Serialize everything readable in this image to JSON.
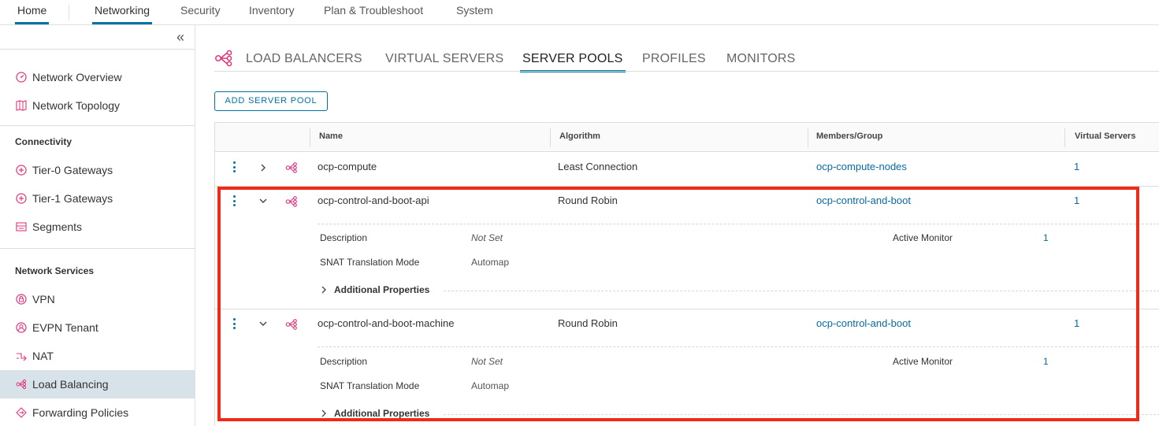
{
  "topnav": {
    "items": [
      {
        "label": "Home",
        "active": true
      },
      {
        "label": "Networking",
        "active": true
      },
      {
        "label": "Security"
      },
      {
        "label": "Inventory"
      },
      {
        "label": "Plan & Troubleshoot"
      },
      {
        "label": "System"
      }
    ]
  },
  "sidebar": {
    "overview": "Network Overview",
    "topology": "Network Topology",
    "connectivity_heading": "Connectivity",
    "tier0": "Tier-0 Gateways",
    "tier1": "Tier-1 Gateways",
    "segments": "Segments",
    "services_heading": "Network Services",
    "vpn": "VPN",
    "evpn": "EVPN Tenant",
    "nat": "NAT",
    "lb": "Load Balancing",
    "fwd": "Forwarding Policies"
  },
  "tabs": {
    "load_balancers": "LOAD BALANCERS",
    "virtual_servers": "VIRTUAL SERVERS",
    "server_pools": "SERVER POOLS",
    "profiles": "PROFILES",
    "monitors": "MONITORS"
  },
  "add_button": "ADD SERVER POOL",
  "grid": {
    "headers": {
      "name": "Name",
      "algorithm": "Algorithm",
      "members": "Members/Group",
      "virtual_servers": "Virtual Servers"
    },
    "rows": [
      {
        "name": "ocp-compute",
        "algorithm": "Least Connection",
        "members": "ocp-compute-nodes",
        "virtual_servers": "1"
      },
      {
        "name": "ocp-control-and-boot-api",
        "algorithm": "Round Robin",
        "members": "ocp-control-and-boot",
        "virtual_servers": "1",
        "details": {
          "description_label": "Description",
          "description_value": "Not Set",
          "snat_label": "SNAT Translation Mode",
          "snat_value": "Automap",
          "active_monitor_label": "Active Monitor",
          "active_monitor_value": "1",
          "additional": "Additional Properties"
        }
      },
      {
        "name": "ocp-control-and-boot-machine",
        "algorithm": "Round Robin",
        "members": "ocp-control-and-boot",
        "virtual_servers": "1",
        "details": {
          "description_label": "Description",
          "description_value": "Not Set",
          "snat_label": "SNAT Translation Mode",
          "snat_value": "Automap",
          "active_monitor_label": "Active Monitor",
          "active_monitor_value": "1",
          "additional": "Additional Properties"
        }
      }
    ]
  },
  "colors": {
    "accent": "#0072a3",
    "lb_icon": "#e0347c",
    "highlight": "#f02a18",
    "selected_bg": "#d8e3e9"
  }
}
